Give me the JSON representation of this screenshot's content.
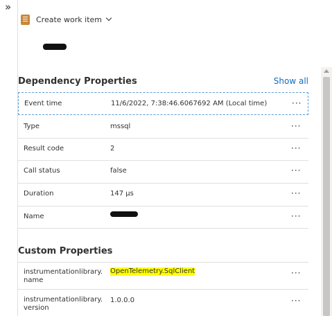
{
  "toolbar": {
    "collapse_glyph": "»",
    "create_work_item_label": "Create work item",
    "work_item_icon": "work-item-icon",
    "dropdown_icon": "chevron-down-icon"
  },
  "dependency": {
    "heading": "Dependency Properties",
    "show_all": "Show all",
    "rows": [
      {
        "name": "Event time",
        "value": "11/6/2022, 7:38:46.6067692 AM (Local time)",
        "more": "···"
      },
      {
        "name": "Type",
        "value": "mssql",
        "more": "···"
      },
      {
        "name": "Result code",
        "value": "2",
        "more": "···"
      },
      {
        "name": "Call status",
        "value": "false",
        "more": "···"
      },
      {
        "name": "Duration",
        "value": "147 μs",
        "more": "···"
      },
      {
        "name": "Name",
        "value": "",
        "more": "···"
      }
    ]
  },
  "custom": {
    "heading": "Custom Properties",
    "rows": [
      {
        "name": "instrumentationlibrary.\nname",
        "value": "OpenTelemetry.SqlClient",
        "more": "···"
      },
      {
        "name": "instrumentationlibrary.\nversion",
        "value": "1.0.0.0",
        "more": "···"
      }
    ]
  },
  "colors": {
    "accent_link": "#106ebe",
    "highlight": "#ffff00",
    "focus_border": "#5a9bd5"
  }
}
